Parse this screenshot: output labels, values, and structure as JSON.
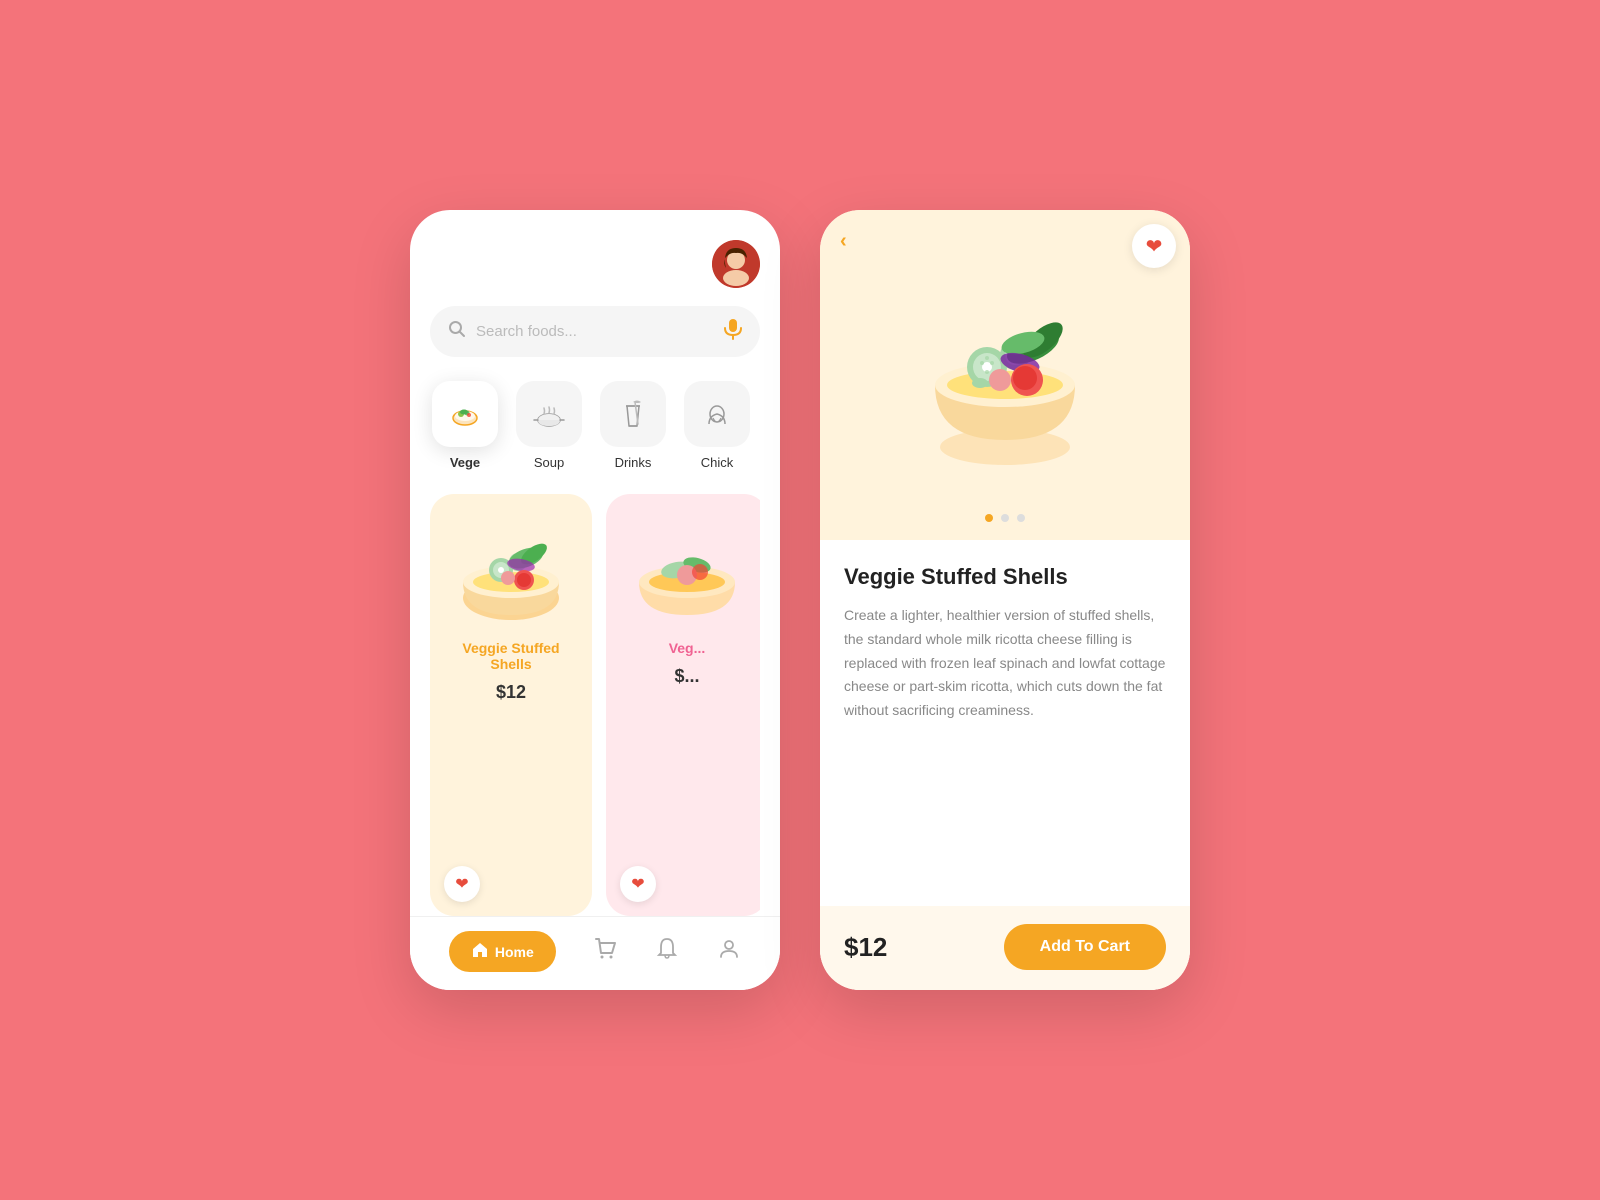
{
  "background_color": "#F4737A",
  "left_phone": {
    "search": {
      "placeholder": "Search foods...",
      "mic_icon": "🎤"
    },
    "categories": [
      {
        "id": "vege",
        "label": "Vege",
        "icon": "🥗",
        "active": true
      },
      {
        "id": "soup",
        "label": "Soup",
        "icon": "🍲",
        "active": false
      },
      {
        "id": "drinks",
        "label": "Drinks",
        "icon": "🍹",
        "active": false
      },
      {
        "id": "chick",
        "label": "Chick",
        "icon": "🍗",
        "active": false
      }
    ],
    "food_cards": [
      {
        "id": "veggie-stuffed-shells-1",
        "title": "Veggie Stuffed Shells",
        "price": "$12",
        "card_color": "yellow",
        "title_color": "orange",
        "favorited": true
      },
      {
        "id": "veg-card-2",
        "title": "Veg...",
        "price": "$...",
        "card_color": "pink",
        "title_color": "pink-color",
        "favorited": true
      }
    ],
    "bottom_nav": {
      "home_label": "Home",
      "cart_icon": "cart",
      "bell_icon": "bell",
      "user_icon": "user"
    }
  },
  "right_phone": {
    "back_label": "‹",
    "product": {
      "title": "Veggie Stuffed Shells",
      "description": "Create a lighter, healthier version of stuffed shells, the standard whole milk ricotta cheese filling is replaced with frozen leaf spinach and lowfat cottage cheese or part-skim ricotta, which cuts down the fat without sacrificing creaminess.",
      "price": "$12",
      "add_to_cart_label": "Add To Cart",
      "favorited": true,
      "image_dots": [
        {
          "active": true
        },
        {
          "active": false
        },
        {
          "active": false
        }
      ]
    }
  }
}
